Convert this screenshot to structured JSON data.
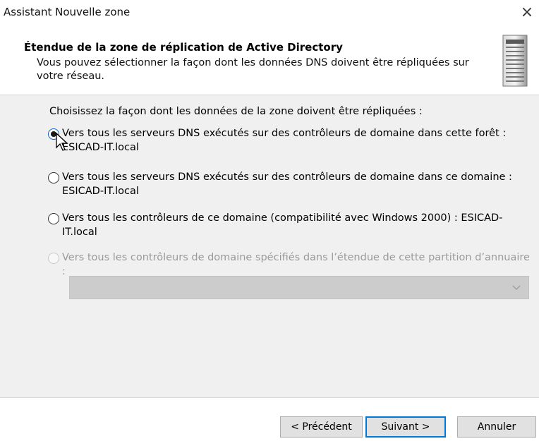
{
  "window": {
    "title": "Assistant Nouvelle zone",
    "close_glyph": "×"
  },
  "header": {
    "title": "Étendue de la zone de réplication de Active Directory",
    "description": "Vous pouvez sélectionner la façon dont les données DNS doivent être répliquées sur votre réseau.",
    "icon": "server-icon"
  },
  "content": {
    "prompt": "Choisissez la façon dont les données de la zone doivent être répliquées :",
    "options": [
      {
        "label": "Vers tous les serveurs DNS exécutés sur des contrôleurs de domaine dans cette forêt : ESICAD-IT.local",
        "selected": true,
        "enabled": true
      },
      {
        "label": "Vers tous les serveurs DNS exécutés sur des contrôleurs de domaine dans ce domaine : ESICAD-IT.local",
        "selected": false,
        "enabled": true
      },
      {
        "label": "Vers tous les contrôleurs de ce domaine (compatibilité avec Windows 2000) : ESICAD-IT.local",
        "selected": false,
        "enabled": true
      },
      {
        "label": "Vers tous les contrôleurs de domaine spécifiés dans l’étendue de cette partition d’annuaire :",
        "selected": false,
        "enabled": false
      }
    ],
    "partition_select": {
      "value": "",
      "enabled": false
    }
  },
  "buttons": {
    "back": "< Précédent",
    "next": "Suivant >",
    "cancel": "Annuler"
  },
  "colors": {
    "content_bg": "#f0f0f0",
    "accent": "#0078d7"
  }
}
